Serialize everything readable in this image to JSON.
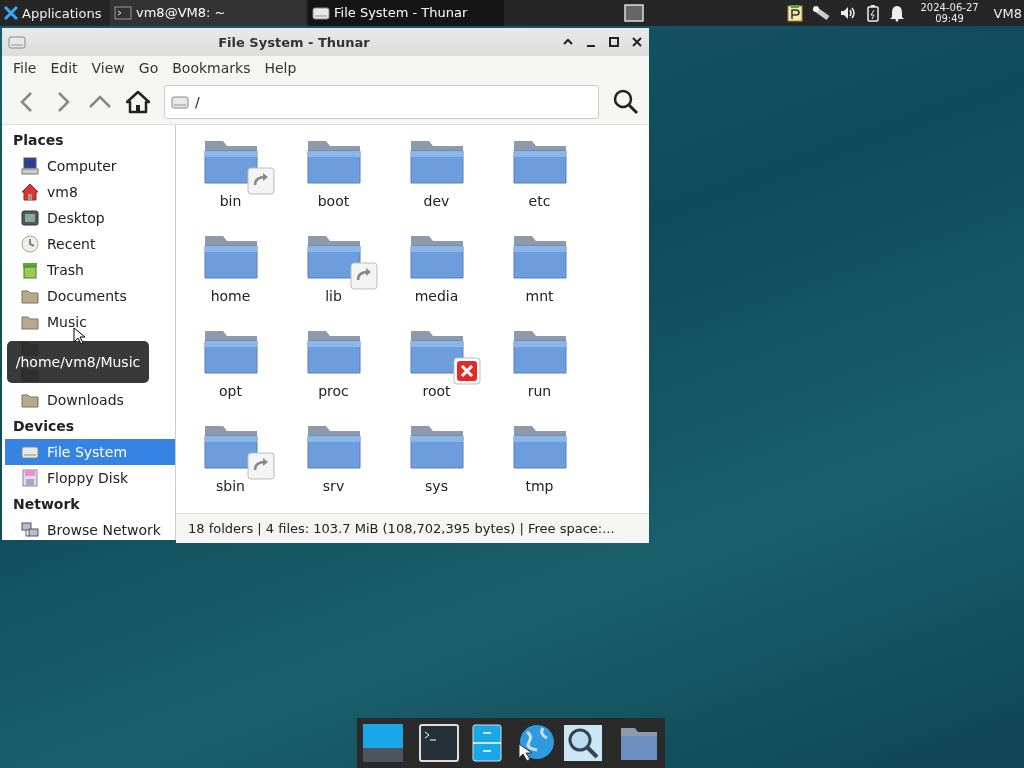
{
  "top_panel": {
    "app_menu": "Applications",
    "tasks": [
      {
        "label": "vm8@VM8: ~",
        "kind": "terminal",
        "selected": false
      },
      {
        "label": "File System - Thunar",
        "kind": "drive",
        "selected": true
      }
    ],
    "clock": {
      "date": "2024-06-27",
      "time": "09:49"
    },
    "user": "VM8"
  },
  "window": {
    "title": "File System - Thunar",
    "menu": [
      "File",
      "Edit",
      "View",
      "Go",
      "Bookmarks",
      "Help"
    ],
    "location": "/",
    "sidebar": [
      {
        "heading": "Places",
        "items": [
          {
            "label": "Computer",
            "kind": "computer",
            "selected": false
          },
          {
            "label": "vm8",
            "kind": "home",
            "selected": false
          },
          {
            "label": "Desktop",
            "kind": "desktop",
            "selected": false
          },
          {
            "label": "Recent",
            "kind": "clock",
            "selected": false
          },
          {
            "label": "Trash",
            "kind": "trash",
            "selected": false
          },
          {
            "label": "Documents",
            "kind": "folder",
            "selected": false
          },
          {
            "label": "Music",
            "kind": "folder",
            "selected": false
          },
          {
            "kind": "folder",
            "selected": false
          },
          {
            "kind": "folder",
            "selected": false
          },
          {
            "label": "Downloads",
            "kind": "folder",
            "selected": false
          }
        ]
      },
      {
        "heading": "Devices",
        "items": [
          {
            "label": "File System",
            "kind": "drive",
            "selected": true
          },
          {
            "label": "Floppy Disk",
            "kind": "floppy",
            "selected": false
          }
        ]
      },
      {
        "heading": "Network",
        "items": [
          {
            "label": "Browse Network",
            "kind": "network",
            "selected": false
          }
        ]
      }
    ],
    "folders": [
      {
        "name": "bin",
        "kind": "symlink"
      },
      {
        "name": "boot",
        "kind": "folder"
      },
      {
        "name": "dev",
        "kind": "folder"
      },
      {
        "name": "etc",
        "kind": "folder"
      },
      {
        "name": "home",
        "kind": "folder"
      },
      {
        "name": "lib",
        "kind": "symlink"
      },
      {
        "name": "media",
        "kind": "folder"
      },
      {
        "name": "mnt",
        "kind": "folder"
      },
      {
        "name": "opt",
        "kind": "folder"
      },
      {
        "name": "proc",
        "kind": "folder"
      },
      {
        "name": "root",
        "kind": "unreadable"
      },
      {
        "name": "run",
        "kind": "folder"
      },
      {
        "name": "sbin",
        "kind": "symlink"
      },
      {
        "name": "srv",
        "kind": "folder"
      },
      {
        "name": "sys",
        "kind": "folder"
      },
      {
        "name": "tmp",
        "kind": "folder"
      }
    ],
    "status_bar": "18 folders  |  4 files: 103.7 MiB (108,702,395 bytes)  |  Free space:...",
    "tooltip": "/home/vm8/Music"
  }
}
